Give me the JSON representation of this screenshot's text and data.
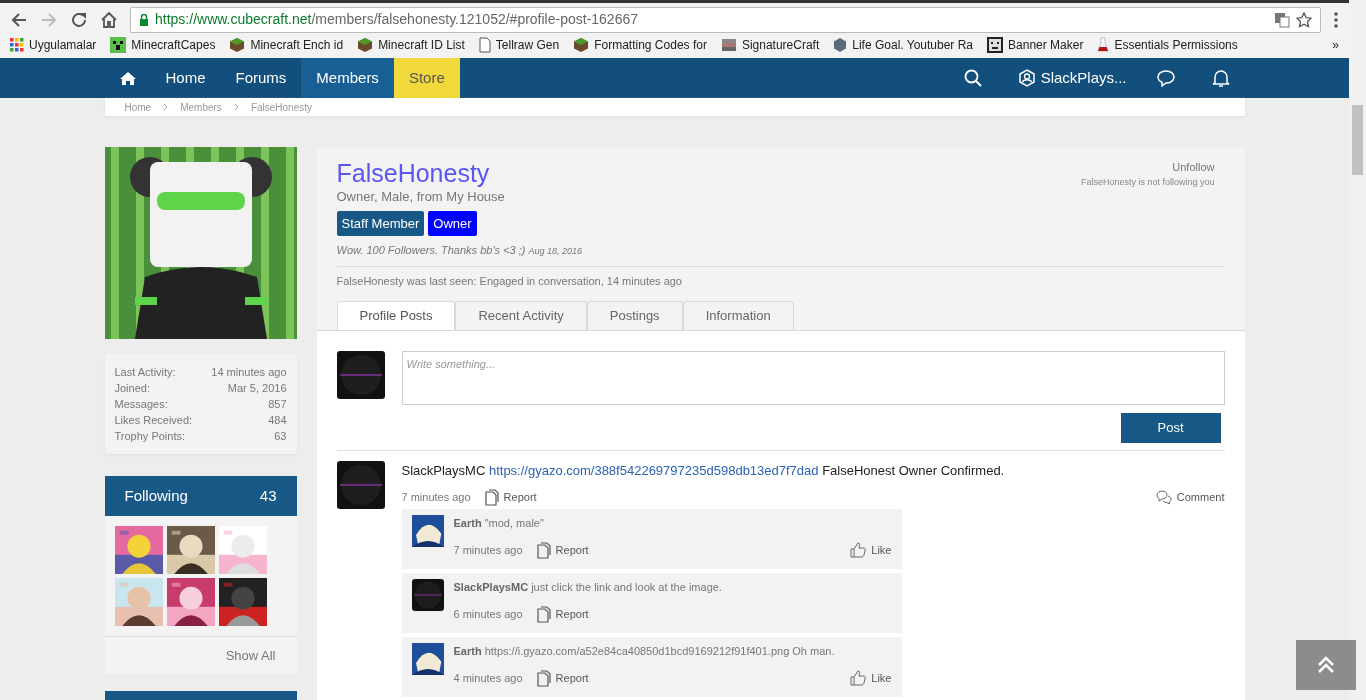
{
  "browser": {
    "url_host": "https://www.cubecraft.net",
    "url_path": "/members/falsehonesty.121052/#profile-post-162667",
    "bookmarks": [
      {
        "label": "Uygulamalar",
        "kind": "apps"
      },
      {
        "label": "MinecraftCapes",
        "kind": "creeper"
      },
      {
        "label": "Minecraft Ench id",
        "kind": "grass"
      },
      {
        "label": "Minecraft ID List",
        "kind": "grass"
      },
      {
        "label": "Tellraw Gen",
        "kind": "page"
      },
      {
        "label": "Formatting Codes for",
        "kind": "grass"
      },
      {
        "label": "SignatureCraft",
        "kind": "stack"
      },
      {
        "label": "Life Goal. Youtuber Ra",
        "kind": "cube"
      },
      {
        "label": "Banner Maker",
        "kind": "pixel"
      },
      {
        "label": "Essentials Permissions",
        "kind": "flask"
      }
    ],
    "more": "»"
  },
  "nav": {
    "items": [
      {
        "label": "Home",
        "kind": "link",
        "selected": false
      },
      {
        "label": "Forums",
        "kind": "link",
        "selected": false
      },
      {
        "label": "Members",
        "kind": "link",
        "selected": true
      },
      {
        "label": "Store",
        "kind": "store",
        "selected": false
      }
    ],
    "user": "SlackPlays..."
  },
  "breadcrumb": [
    "Home",
    "Members",
    "FalseHonesty"
  ],
  "stats": [
    {
      "label": "Last Activity:",
      "value": "14 minutes ago"
    },
    {
      "label": "Joined:",
      "value": "Mar 5, 2016"
    },
    {
      "label": "Messages:",
      "value": "857"
    },
    {
      "label": "Likes Received:",
      "value": "484"
    },
    {
      "label": "Trophy Points:",
      "value": "63"
    }
  ],
  "following": {
    "title": "Following",
    "count": "43",
    "show_all": "Show All"
  },
  "profile": {
    "name": "FalseHonesty",
    "subtitle": "Owner, Male, from My House",
    "badges": [
      {
        "label": "Staff Member",
        "color": "#185886"
      },
      {
        "label": "Owner",
        "color": "#0000ff"
      }
    ],
    "status": "Wow. 100 Followers. Thanks bb's <3 ;)",
    "status_date": "Aug 18, 2016",
    "last_seen": "FalseHonesty was last seen: Engaged in conversation, 14 minutes ago",
    "follow_action": "Unfollow",
    "follow_note": "FalseHonesty is not following you"
  },
  "tabs": [
    {
      "label": "Profile Posts",
      "selected": true
    },
    {
      "label": "Recent Activity",
      "selected": false
    },
    {
      "label": "Postings",
      "selected": false
    },
    {
      "label": "Information",
      "selected": false
    }
  ],
  "composer": {
    "placeholder": "Write something...",
    "button": "Post"
  },
  "post": {
    "author": "SlackPlaysMC",
    "link": "https://gyazo.com/388f542269797235d598db13ed7f7dad",
    "text": "FalseHonest Owner Confirmed.",
    "time": "7 minutes ago",
    "report": "Report",
    "comment": "Comment"
  },
  "comments": [
    {
      "author": "Earth",
      "text": "\"mod, male\"",
      "time": "7 minutes ago",
      "report": "Report",
      "like": "Like"
    },
    {
      "author": "SlackPlaysMC",
      "text": "just click the link and look at the image.",
      "time": "6 minutes ago",
      "report": "Report"
    },
    {
      "author": "Earth",
      "text": "https://i.gyazo.com/a52e84ca40850d1bcd9169212f91f401.png Oh man.",
      "time": "4 minutes ago",
      "report": "Report",
      "like": "Like"
    }
  ]
}
